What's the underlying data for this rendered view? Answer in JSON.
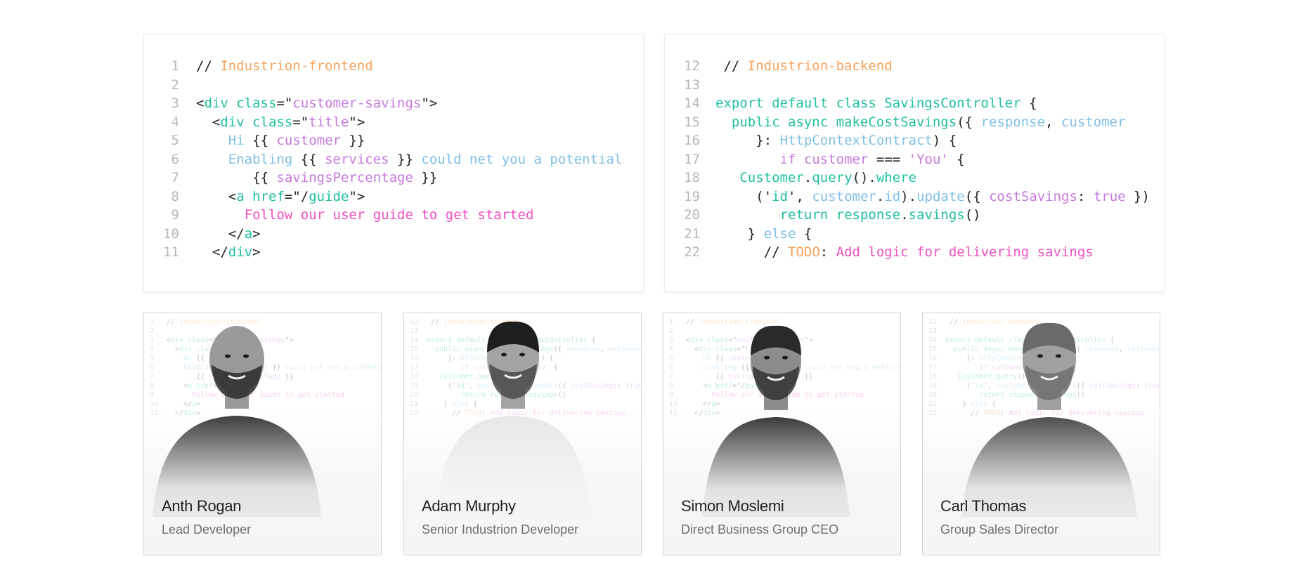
{
  "code_left": {
    "lines": [
      {
        "n": "1",
        "indent": 0,
        "tokens": [
          [
            "// ",
            "com"
          ],
          [
            "Industrion-frontend",
            "org"
          ]
        ]
      },
      {
        "n": "2",
        "indent": 0,
        "tokens": []
      },
      {
        "n": "3",
        "indent": 0,
        "tokens": [
          [
            "<",
            "dk"
          ],
          [
            "div",
            "tag"
          ],
          [
            " class",
            "tag"
          ],
          [
            "=\"",
            "dk"
          ],
          [
            "customer",
            "pur"
          ],
          [
            "-",
            "pur"
          ],
          [
            "savings",
            "pur"
          ],
          [
            "\">",
            "dk"
          ]
        ]
      },
      {
        "n": "4",
        "indent": 2,
        "tokens": [
          [
            "<",
            "dk"
          ],
          [
            "div",
            "tag"
          ],
          [
            " class",
            "tag"
          ],
          [
            "=\"",
            "dk"
          ],
          [
            "title",
            "pur"
          ],
          [
            "\">",
            "dk"
          ]
        ]
      },
      {
        "n": "5",
        "indent": 4,
        "tokens": [
          [
            "Hi ",
            "blu"
          ],
          [
            "{{ ",
            "dk"
          ],
          [
            "customer",
            "pur"
          ],
          [
            " }}",
            "dk"
          ]
        ]
      },
      {
        "n": "6",
        "indent": 4,
        "tokens": [
          [
            "Enabling ",
            "blu"
          ],
          [
            "{{ ",
            "dk"
          ],
          [
            "services",
            "pur"
          ],
          [
            " }} ",
            "dk"
          ],
          [
            "could net you a potential",
            "blu"
          ]
        ]
      },
      {
        "n": "7",
        "indent": 7,
        "tokens": [
          [
            "{{ ",
            "dk"
          ],
          [
            "savingsPercentage",
            "pur"
          ],
          [
            " }}",
            "dk"
          ]
        ]
      },
      {
        "n": "8",
        "indent": 4,
        "tokens": [
          [
            "<",
            "dk"
          ],
          [
            "a",
            "tag"
          ],
          [
            " href",
            "tag"
          ],
          [
            "=\"/",
            "dk"
          ],
          [
            "guide",
            "tag"
          ],
          [
            "\">",
            "dk"
          ]
        ]
      },
      {
        "n": "9",
        "indent": 6,
        "tokens": [
          [
            "Follow our user guide to get started",
            "pnk"
          ]
        ]
      },
      {
        "n": "10",
        "indent": 4,
        "tokens": [
          [
            "</",
            "dk"
          ],
          [
            "a",
            "tag"
          ],
          [
            ">",
            "dk"
          ]
        ]
      },
      {
        "n": "11",
        "indent": 2,
        "tokens": [
          [
            "</",
            "dk"
          ],
          [
            "div",
            "tag"
          ],
          [
            ">",
            "dk"
          ]
        ]
      }
    ]
  },
  "code_right": {
    "lines": [
      {
        "n": "12",
        "indent": 1,
        "tokens": [
          [
            "// ",
            "com"
          ],
          [
            "Industrion-backend",
            "org"
          ]
        ]
      },
      {
        "n": "13",
        "indent": 0,
        "tokens": []
      },
      {
        "n": "14",
        "indent": 0,
        "tokens": [
          [
            "export default class SavingsController ",
            "tag"
          ],
          [
            "{",
            "dk"
          ]
        ]
      },
      {
        "n": "15",
        "indent": 2,
        "tokens": [
          [
            "public async makeCostSavings",
            "tag"
          ],
          [
            "({ ",
            "dk"
          ],
          [
            "response",
            "blu"
          ],
          [
            ", ",
            "dk"
          ],
          [
            "customer",
            "blu"
          ]
        ]
      },
      {
        "n": "16",
        "indent": 5,
        "tokens": [
          [
            "}: ",
            "dk"
          ],
          [
            "HttpContextContract",
            "blu"
          ],
          [
            ") {",
            "dk"
          ]
        ]
      },
      {
        "n": "17",
        "indent": 8,
        "tokens": [
          [
            "if ",
            "pur"
          ],
          [
            "customer ",
            "pur"
          ],
          [
            "=== ",
            "dk"
          ],
          [
            "'You'",
            "pur"
          ],
          [
            " {",
            "dk"
          ]
        ]
      },
      {
        "n": "18",
        "indent": 3,
        "tokens": [
          [
            "Customer",
            "tag"
          ],
          [
            ".",
            "dk"
          ],
          [
            "query",
            "tag"
          ],
          [
            "().",
            "dk"
          ],
          [
            "where",
            "tag"
          ]
        ]
      },
      {
        "n": "19",
        "indent": 5,
        "tokens": [
          [
            "('",
            "dk"
          ],
          [
            "id",
            "tag"
          ],
          [
            "', ",
            "dk"
          ],
          [
            "customer",
            "blu"
          ],
          [
            ".",
            "dk"
          ],
          [
            "id",
            "blu"
          ],
          [
            ").",
            "dk"
          ],
          [
            "update",
            "blu"
          ],
          [
            "({ ",
            "dk"
          ],
          [
            "costSavings",
            "pur"
          ],
          [
            ": ",
            "dk"
          ],
          [
            "true",
            "pur"
          ],
          [
            " })",
            "dk"
          ]
        ]
      },
      {
        "n": "20",
        "indent": 8,
        "tokens": [
          [
            "return ",
            "tag"
          ],
          [
            "response",
            "tag"
          ],
          [
            ".",
            "dk"
          ],
          [
            "savings",
            "tag"
          ],
          [
            "()",
            "dk"
          ]
        ]
      },
      {
        "n": "21",
        "indent": 4,
        "tokens": [
          [
            "} ",
            "dk"
          ],
          [
            "else",
            "blu"
          ],
          [
            " {",
            "dk"
          ]
        ]
      },
      {
        "n": "22",
        "indent": 6,
        "tokens": [
          [
            "// ",
            "dk"
          ],
          [
            "TODO",
            "org"
          ],
          [
            ": ",
            "dk"
          ],
          [
            "Add logic for delivering savings",
            "pnk"
          ]
        ]
      }
    ]
  },
  "team": [
    {
      "name": "Anth Rogan",
      "role": "Lead Developer",
      "bg": "frontend",
      "look": "bald-beard"
    },
    {
      "name": "Adam Murphy",
      "role": "Senior Industrion Developer",
      "bg": "backend",
      "look": "dark-hair"
    },
    {
      "name": "Simon Moslemi",
      "role": "Direct Business Group CEO",
      "bg": "frontend",
      "look": "bald-dark"
    },
    {
      "name": "Carl Thomas",
      "role": "Group Sales Director",
      "bg": "backend",
      "look": "grey-hair"
    }
  ]
}
